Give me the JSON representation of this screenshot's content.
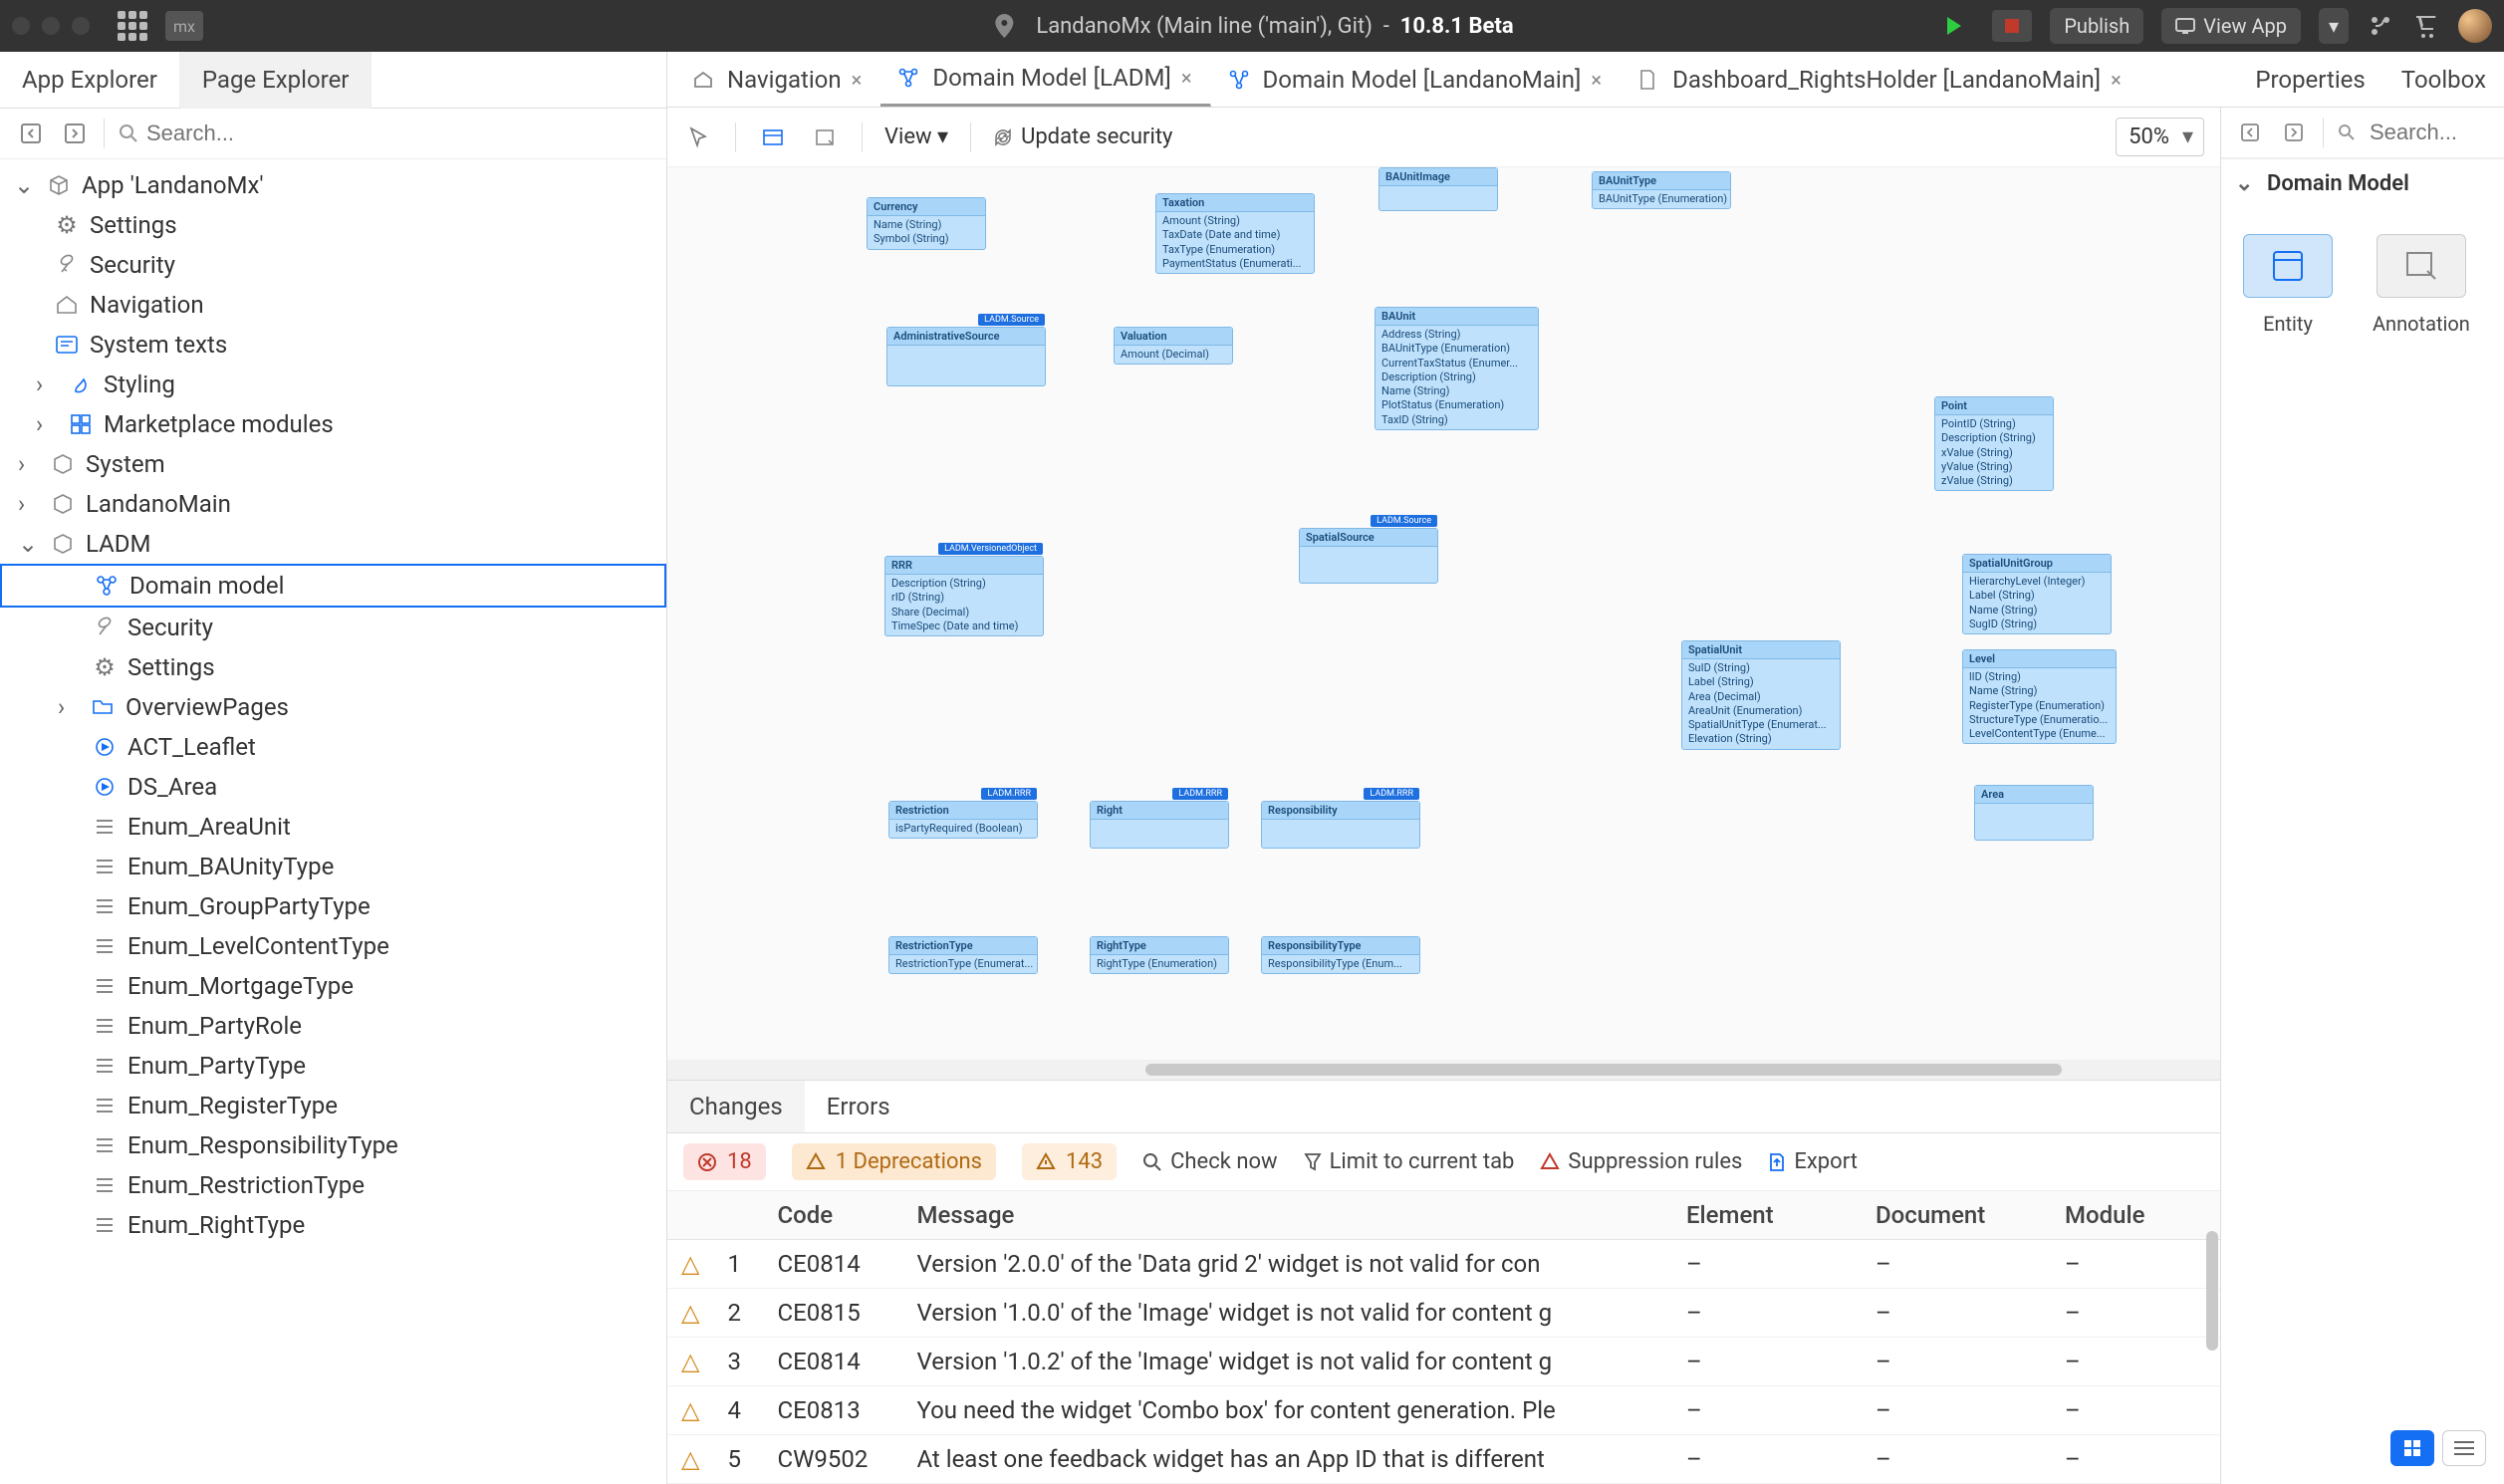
{
  "titlebar": {
    "project": "LandanoMx (Main line ('main'), Git)",
    "version": "10.8.1 Beta",
    "publish": "Publish",
    "view_app": "View App"
  },
  "side_tabs": {
    "app_explorer": "App Explorer",
    "page_explorer": "Page Explorer"
  },
  "search": {
    "placeholder": "Search..."
  },
  "tree": {
    "app": "App 'LandanoMx'",
    "settings": "Settings",
    "security": "Security",
    "navigation": "Navigation",
    "system_texts": "System texts",
    "styling": "Styling",
    "marketplace": "Marketplace modules",
    "system": "System",
    "landano_main": "LandanoMain",
    "ladm": "LADM",
    "domain_model": "Domain model",
    "security2": "Security",
    "settings2": "Settings",
    "overview_pages": "OverviewPages",
    "act_leaflet": "ACT_Leaflet",
    "ds_area": "DS_Area",
    "enum_area_unit": "Enum_AreaUnit",
    "enum_baunity": "Enum_BAUnityType",
    "enum_groupparty": "Enum_GroupPartyType",
    "enum_levelcontent": "Enum_LevelContentType",
    "enum_mortgage": "Enum_MortgageType",
    "enum_partyrole": "Enum_PartyRole",
    "enum_partytype": "Enum_PartyType",
    "enum_register": "Enum_RegisterType",
    "enum_responsibility": "Enum_ResponsibilityType",
    "enum_restriction": "Enum_RestrictionType",
    "enum_righttype": "Enum_RightType"
  },
  "doc_tabs": {
    "navigation": "Navigation",
    "ladm": "Domain Model [LADM]",
    "landano_main": "Domain Model [LandanoMain]",
    "dashboard": "Dashboard_RightsHolder [LandanoMain]",
    "properties": "Properties",
    "toolbox": "Toolbox"
  },
  "editor_toolbar": {
    "view": "View",
    "update_security": "Update security",
    "zoom": "50%"
  },
  "right_panel": {
    "search_placeholder": "Search...",
    "section": "Domain Model",
    "entity": "Entity",
    "annotation": "Annotation"
  },
  "bottom": {
    "tab_changes": "Changes",
    "tab_errors": "Errors",
    "err_count": "18",
    "dep_count": "1 Deprecations",
    "warn_count": "143",
    "check_now": "Check now",
    "limit_tab": "Limit to current tab",
    "suppression": "Suppression rules",
    "export": "Export",
    "cols": {
      "code": "Code",
      "message": "Message",
      "element": "Element",
      "document": "Document",
      "module": "Module"
    },
    "rows": [
      {
        "n": "1",
        "code": "CE0814",
        "msg": "Version '2.0.0' of the 'Data grid 2' widget is not valid for con",
        "el": "–",
        "doc": "–",
        "mod": "–"
      },
      {
        "n": "2",
        "code": "CE0815",
        "msg": "Version '1.0.0' of the 'Image' widget is not valid for content g",
        "el": "–",
        "doc": "–",
        "mod": "–"
      },
      {
        "n": "3",
        "code": "CE0814",
        "msg": "Version '1.0.2' of the 'Image' widget is not valid for content g",
        "el": "–",
        "doc": "–",
        "mod": "–"
      },
      {
        "n": "4",
        "code": "CE0813",
        "msg": "You need the widget 'Combo box' for content generation. Ple",
        "el": "–",
        "doc": "–",
        "mod": "–"
      },
      {
        "n": "5",
        "code": "CW9502",
        "msg": "At least one feedback widget has an App ID that is different",
        "el": "–",
        "doc": "–",
        "mod": "–"
      }
    ]
  },
  "entities": {
    "currency": {
      "name": "Currency",
      "attrs": "Name (String)\nSymbol (String)"
    },
    "taxation": {
      "name": "Taxation",
      "attrs": "Amount (String)\nTaxDate (Date and time)\nTaxType (Enumeration)\nPaymentStatus (Enumerati..."
    },
    "baunitimage": {
      "name": "BAUnitImage",
      "attrs": ""
    },
    "baunittype": {
      "name": "BAUnitType",
      "attrs": "BAUnitType (Enumeration)"
    },
    "adminsource": {
      "name": "AdministrativeSource",
      "badge": "LADM.Source",
      "attrs": ""
    },
    "valuation": {
      "name": "Valuation",
      "attrs": "Amount (Decimal)"
    },
    "baunit": {
      "name": "BAUnit",
      "attrs": "Address (String)\nBAUnitType (Enumeration)\nCurrentTaxStatus (Enumer...\nDescription (String)\nName (String)\nPlotStatus (Enumeration)\nTaxID (String)"
    },
    "point": {
      "name": "Point",
      "attrs": "PointID (String)\nDescription (String)\nxValue (String)\nyValue (String)\nzValue (String)"
    },
    "rrr": {
      "name": "RRR",
      "badge": "LADM.VersionedObject",
      "attrs": "Description (String)\nrID (String)\nShare (Decimal)\nTimeSpec (Date and time)"
    },
    "spatialsource": {
      "name": "SpatialSource",
      "badge": "LADM.Source",
      "attrs": ""
    },
    "spatialunitgroup": {
      "name": "SpatialUnitGroup",
      "attrs": "HierarchyLevel (Integer)\nLabel (String)\nName (String)\nSugID (String)"
    },
    "spatialunit": {
      "name": "SpatialUnit",
      "attrs": "SuID (String)\nLabel (String)\nArea (Decimal)\nAreaUnit (Enumeration)\nSpatialUnitType (Enumerat...\nElevation (String)"
    },
    "level": {
      "name": "Level",
      "attrs": "lID (String)\nName (String)\nRegisterType (Enumeration)\nStructureType (Enumeratio...\nLevelContentType (Enume..."
    },
    "area": {
      "name": "Area",
      "attrs": ""
    },
    "restriction": {
      "name": "Restriction",
      "badge": "LADM.RRR",
      "attrs": "isPartyRequired (Boolean)"
    },
    "right": {
      "name": "Right",
      "badge": "LADM.RRR",
      "attrs": ""
    },
    "responsibility": {
      "name": "Responsibility",
      "badge": "LADM.RRR",
      "attrs": ""
    },
    "restrictiontype": {
      "name": "RestrictionType",
      "attrs": "RestrictionType (Enumerat..."
    },
    "righttype": {
      "name": "RightType",
      "attrs": "RightType (Enumeration)"
    },
    "responsibilitytype": {
      "name": "ResponsibilityType",
      "attrs": "ResponsibilityType (Enum..."
    }
  }
}
